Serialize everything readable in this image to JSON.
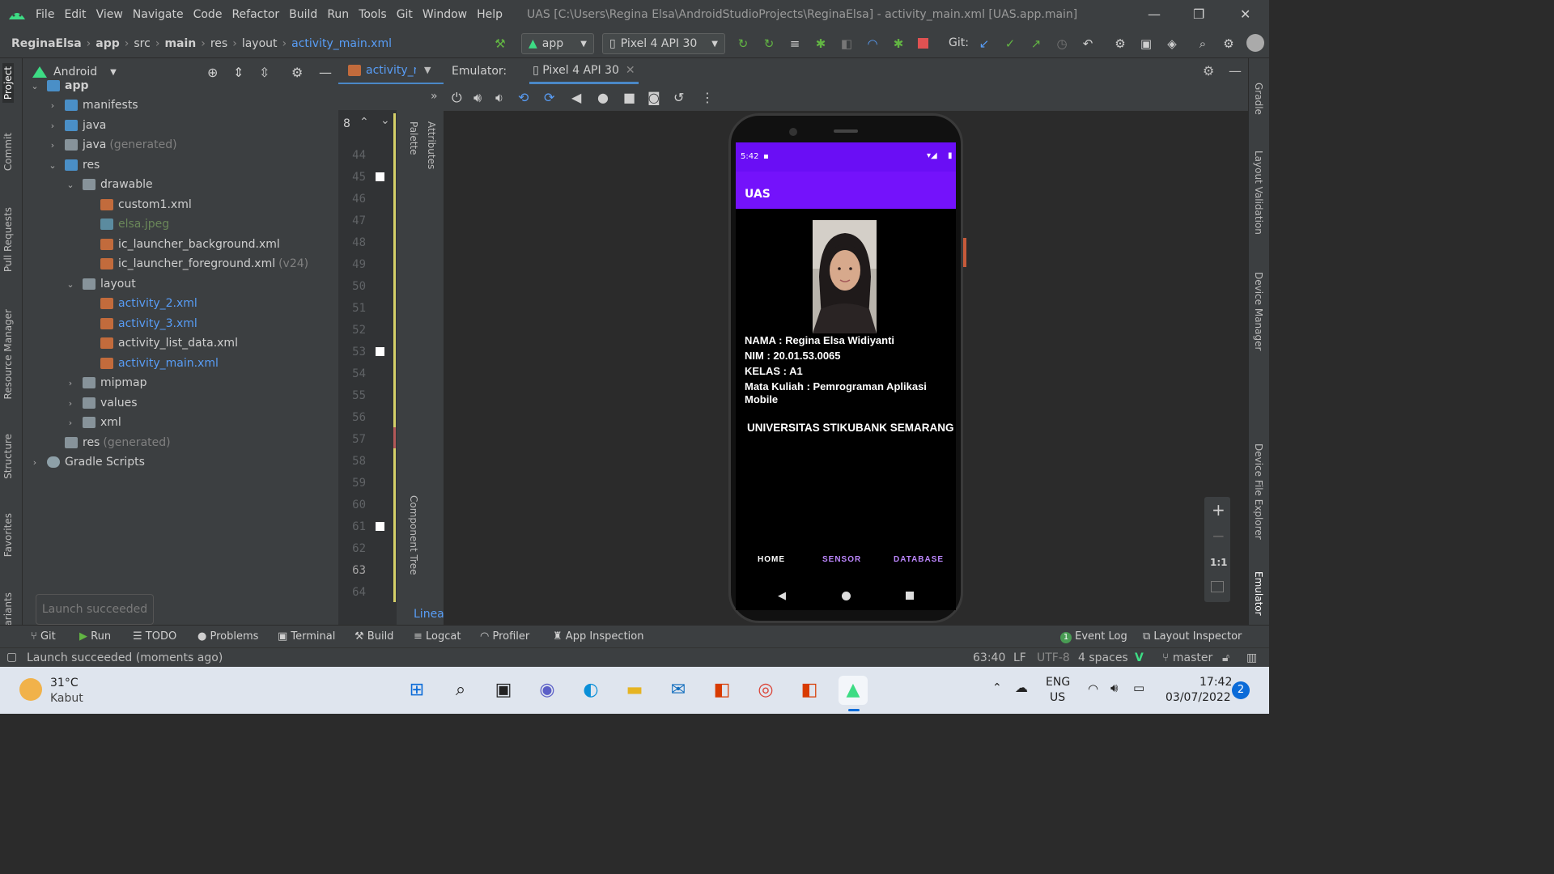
{
  "window": {
    "menu": [
      "File",
      "Edit",
      "View",
      "Navigate",
      "Code",
      "Refactor",
      "Build",
      "Run",
      "Tools",
      "Git",
      "Window",
      "Help"
    ],
    "title": "UAS [C:\\Users\\Regina Elsa\\AndroidStudioProjects\\ReginaElsa] - activity_main.xml [UAS.app.main]"
  },
  "breadcrumb": [
    "ReginaElsa",
    "app",
    "src",
    "main",
    "res",
    "layout",
    "activity_main.xml"
  ],
  "toolbar": {
    "run_config": "app",
    "device": "Pixel 4 API 30",
    "git_label": "Git:"
  },
  "left_tabs": [
    "Project",
    "Commit",
    "Pull Requests",
    "Resource Manager",
    "Structure",
    "Favorites",
    "ariants"
  ],
  "right_tabs": [
    "Gradle",
    "Layout Validation",
    "Device Manager",
    "Device File Explorer",
    "Emulator"
  ],
  "project": {
    "view": "Android",
    "tree": [
      {
        "label": "app",
        "level": 0,
        "kind": "module",
        "expanded": true
      },
      {
        "label": "manifests",
        "level": 1,
        "kind": "folder-blue",
        "expanded": false
      },
      {
        "label": "java",
        "level": 1,
        "kind": "folder-blue",
        "expanded": false
      },
      {
        "label": "java",
        "suffix": "(generated)",
        "level": 1,
        "kind": "folder-gen",
        "expanded": false
      },
      {
        "label": "res",
        "level": 1,
        "kind": "folder-blue",
        "expanded": true
      },
      {
        "label": "drawable",
        "level": 2,
        "kind": "folder",
        "expanded": true
      },
      {
        "label": "custom1.xml",
        "level": 3,
        "kind": "xml"
      },
      {
        "label": "elsa.jpeg",
        "level": 3,
        "kind": "image",
        "color": "#6a8759"
      },
      {
        "label": "ic_launcher_background.xml",
        "level": 3,
        "kind": "xml"
      },
      {
        "label": "ic_launcher_foreground.xml",
        "suffix": "(v24)",
        "level": 3,
        "kind": "xml"
      },
      {
        "label": "layout",
        "level": 2,
        "kind": "folder",
        "expanded": true
      },
      {
        "label": "activity_2.xml",
        "level": 3,
        "kind": "xml",
        "color": "#589df6"
      },
      {
        "label": "activity_3.xml",
        "level": 3,
        "kind": "xml",
        "color": "#589df6"
      },
      {
        "label": "activity_list_data.xml",
        "level": 3,
        "kind": "xml"
      },
      {
        "label": "activity_main.xml",
        "level": 3,
        "kind": "xml",
        "color": "#589df6"
      },
      {
        "label": "mipmap",
        "level": 2,
        "kind": "folder",
        "expanded": false
      },
      {
        "label": "values",
        "level": 2,
        "kind": "folder",
        "expanded": false
      },
      {
        "label": "xml",
        "level": 2,
        "kind": "folder",
        "expanded": false
      },
      {
        "label": "res",
        "suffix": "(generated)",
        "level": 1,
        "kind": "folder",
        "expanded": null
      },
      {
        "label": "Gradle Scripts",
        "level": 0,
        "kind": "gradle",
        "expanded": false
      }
    ]
  },
  "editor": {
    "tab": "activity_m",
    "line_numbers": [
      "44",
      "45",
      "46",
      "47",
      "48",
      "49",
      "50",
      "51",
      "52",
      "53",
      "54",
      "55",
      "56",
      "57",
      "58",
      "59",
      "60",
      "61",
      "62",
      "63",
      "64"
    ],
    "find_count": "8",
    "palette": "Palette",
    "attributes": "Attributes",
    "component_tree": "Component Tree",
    "footer": "Linear"
  },
  "emulator": {
    "label": "Emulator:",
    "tab": "Pixel 4 API 30",
    "zoom_ratio": "1:1"
  },
  "phone": {
    "time": "5:42",
    "app_title": "UAS",
    "nama": "NAMA    : Regina Elsa Widiyanti",
    "nim": "NIM      :  20.01.53.0065",
    "kelas": "KELAS   :  A1",
    "matkul_1": "Mata Kuliah : Pemrograman Aplikasi",
    "matkul_2": "Mobile",
    "university": "UNIVERSITAS STIKUBANK SEMARANG",
    "nav": {
      "home": "HOME",
      "sensor": "SENSOR",
      "database": "DATABASE"
    }
  },
  "toast": "Launch succeeded",
  "tool_windows": {
    "left": [
      "Git",
      "Run",
      "TODO",
      "Problems",
      "Terminal",
      "Build",
      "Logcat",
      "Profiler",
      "App Inspection"
    ],
    "event_log": "Event Log",
    "event_log_count": "1",
    "layout_inspector": "Layout Inspector"
  },
  "status": {
    "message": "Launch succeeded (moments ago)",
    "position": "63:40",
    "line_sep": "LF",
    "encoding": "UTF-8",
    "indent": "4 spaces",
    "branch": "master"
  },
  "taskbar": {
    "temp": "31°C",
    "weather": "Kabut",
    "lang_1": "ENG",
    "lang_2": "US",
    "time": "17:42",
    "date": "03/07/2022",
    "notifications": "2"
  }
}
